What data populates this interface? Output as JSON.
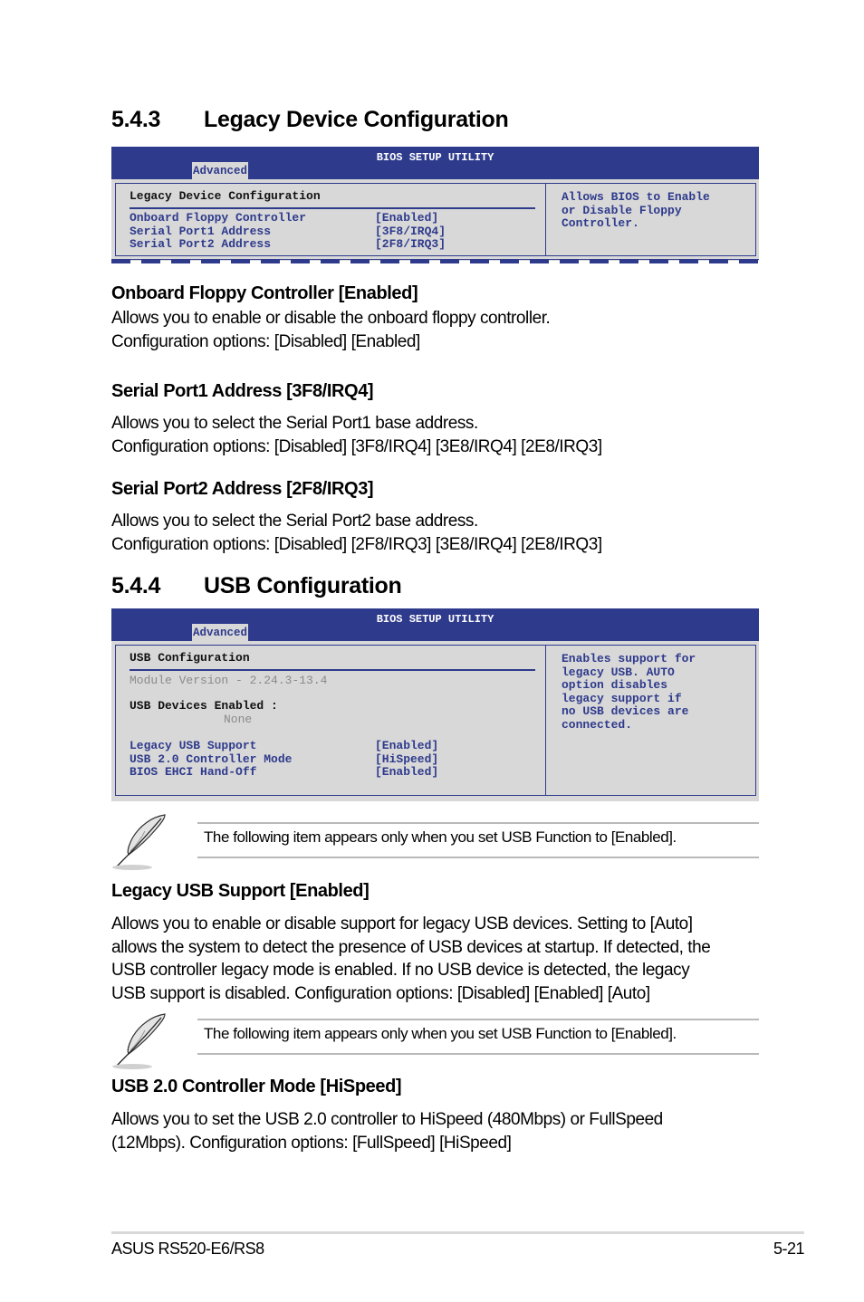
{
  "section_543": {
    "number": "5.4.3",
    "title": "Legacy Device Configuration",
    "bios": {
      "header_title": "BIOS SETUP UTILITY",
      "active_tab": "Advanced",
      "panel_title": "Legacy Device Configuration",
      "items": [
        {
          "label": "Onboard Floppy Controller",
          "value": "[Enabled]"
        },
        {
          "label": "Serial Port1 Address",
          "value": "[3F8/IRQ4]"
        },
        {
          "label": "Serial Port2 Address",
          "value": "[2F8/IRQ3]"
        }
      ],
      "help_lines": [
        "Allows BIOS to Enable",
        "or Disable Floppy",
        "Controller."
      ]
    },
    "entries": [
      {
        "heading": "Onboard Floppy Controller [Enabled]",
        "lines": [
          "Allows you to enable or disable the onboard floppy controller.",
          "Configuration options: [Disabled] [Enabled]"
        ]
      },
      {
        "heading": "Serial Port1 Address [3F8/IRQ4]",
        "lines": [
          "Allows you to select the Serial Port1 base address.",
          "Configuration options: [Disabled] [3F8/IRQ4] [3E8/IRQ4] [2E8/IRQ3]"
        ]
      },
      {
        "heading": "Serial Port2 Address [2F8/IRQ3]",
        "lines": [
          "Allows you to select the Serial Port2 base address.",
          "Configuration options: [Disabled] [2F8/IRQ3] [3E8/IRQ4] [2E8/IRQ3]"
        ]
      }
    ]
  },
  "section_544": {
    "number": "5.4.4",
    "title": "USB Configuration",
    "bios": {
      "header_title": "BIOS SETUP UTILITY",
      "active_tab": "Advanced",
      "panel_title": "USB Configuration",
      "module_version": "Module Version - 2.24.3-13.4",
      "devices_label": "USB Devices Enabled :",
      "devices_value": "None",
      "items": [
        {
          "label": "Legacy USB Support",
          "value": "[Enabled]"
        },
        {
          "label": "USB 2.0 Controller Mode",
          "value": "[HiSpeed]"
        },
        {
          "label": "BIOS EHCI Hand-Off",
          "value": "[Enabled]"
        }
      ],
      "help_lines": [
        "Enables support for",
        "legacy USB. AUTO",
        "option disables",
        "legacy support if",
        "no USB devices are",
        "connected."
      ]
    },
    "notes": [
      "The following item appears only when you set USB Function to [Enabled].",
      "The following item appears only when you set USB Function to [Enabled]."
    ],
    "entries": [
      {
        "heading": "Legacy USB Support [Enabled]",
        "lines": [
          "Allows you to enable or disable support for legacy USB devices. Setting to [Auto]",
          "allows the system to detect the presence of USB devices at startup. If detected, the",
          "USB controller legacy mode is enabled. If no USB device is detected, the legacy",
          "USB support is disabled. Configuration options: [Disabled] [Enabled] [Auto]"
        ]
      },
      {
        "heading": "USB 2.0 Controller Mode [HiSpeed]",
        "lines": [
          "Allows you to set the USB 2.0 controller to HiSpeed (480Mbps) or FullSpeed",
          "(12Mbps). Configuration options: [FullSpeed] [HiSpeed]"
        ]
      }
    ]
  },
  "footer": {
    "product": "ASUS RS520-E6/RS8",
    "page": "5-21"
  },
  "colors": {
    "bios_blue": "#2e3a8c",
    "bios_gray": "#d8d8d8"
  }
}
